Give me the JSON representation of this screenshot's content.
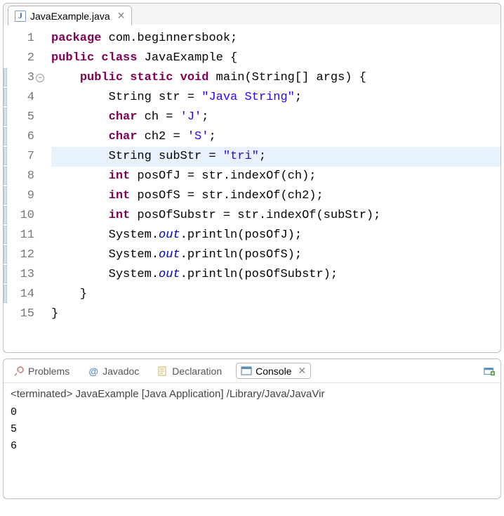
{
  "editor": {
    "tab": {
      "filename": "JavaExample.java"
    },
    "gutter": {
      "lines": [
        "1",
        "2",
        "3",
        "4",
        "5",
        "6",
        "7",
        "8",
        "9",
        "10",
        "11",
        "12",
        "13",
        "14",
        "15"
      ],
      "foldable": [
        3
      ],
      "ruler_marks": [
        3,
        4,
        5,
        6,
        7,
        8,
        9,
        10,
        11,
        12,
        13,
        14
      ],
      "highlighted_line": 7
    },
    "code": [
      [
        [
          "kw",
          "package"
        ],
        [
          "plain",
          " com.beginnersbook;"
        ]
      ],
      [
        [
          "kw",
          "public"
        ],
        [
          "plain",
          " "
        ],
        [
          "kw",
          "class"
        ],
        [
          "plain",
          " JavaExample {"
        ]
      ],
      [
        [
          "plain",
          "    "
        ],
        [
          "kw",
          "public"
        ],
        [
          "plain",
          " "
        ],
        [
          "kw",
          "static"
        ],
        [
          "plain",
          " "
        ],
        [
          "kw",
          "void"
        ],
        [
          "plain",
          " main(String[] args) {"
        ]
      ],
      [
        [
          "plain",
          "        String str = "
        ],
        [
          "str",
          "\"Java String\""
        ],
        [
          "plain",
          ";"
        ]
      ],
      [
        [
          "plain",
          "        "
        ],
        [
          "kw",
          "char"
        ],
        [
          "plain",
          " ch = "
        ],
        [
          "str",
          "'J'"
        ],
        [
          "plain",
          ";"
        ]
      ],
      [
        [
          "plain",
          "        "
        ],
        [
          "kw",
          "char"
        ],
        [
          "plain",
          " ch2 = "
        ],
        [
          "str",
          "'S'"
        ],
        [
          "plain",
          ";"
        ]
      ],
      [
        [
          "plain",
          "        String subStr = "
        ],
        [
          "str",
          "\"tri\""
        ],
        [
          "plain",
          ";"
        ]
      ],
      [
        [
          "plain",
          "        "
        ],
        [
          "kw",
          "int"
        ],
        [
          "plain",
          " posOfJ = str.indexOf(ch);"
        ]
      ],
      [
        [
          "plain",
          "        "
        ],
        [
          "kw",
          "int"
        ],
        [
          "plain",
          " posOfS = str.indexOf(ch2);"
        ]
      ],
      [
        [
          "plain",
          "        "
        ],
        [
          "kw",
          "int"
        ],
        [
          "plain",
          " posOfSubstr = str.indexOf(subStr);"
        ]
      ],
      [
        [
          "plain",
          "        System."
        ],
        [
          "field",
          "out"
        ],
        [
          "plain",
          ".println(posOfJ);"
        ]
      ],
      [
        [
          "plain",
          "        System."
        ],
        [
          "field",
          "out"
        ],
        [
          "plain",
          ".println(posOfS);"
        ]
      ],
      [
        [
          "plain",
          "        System."
        ],
        [
          "field",
          "out"
        ],
        [
          "plain",
          ".println(posOfSubstr);"
        ]
      ],
      [
        [
          "plain",
          "    }"
        ]
      ],
      [
        [
          "plain",
          "}"
        ]
      ]
    ]
  },
  "bottom": {
    "tabs": {
      "problems": "Problems",
      "javadoc": "Javadoc",
      "declaration": "Declaration",
      "console": "Console"
    },
    "console": {
      "title": "<terminated> JavaExample [Java Application] /Library/Java/JavaVir",
      "output": [
        "0",
        "5",
        "6"
      ]
    }
  }
}
